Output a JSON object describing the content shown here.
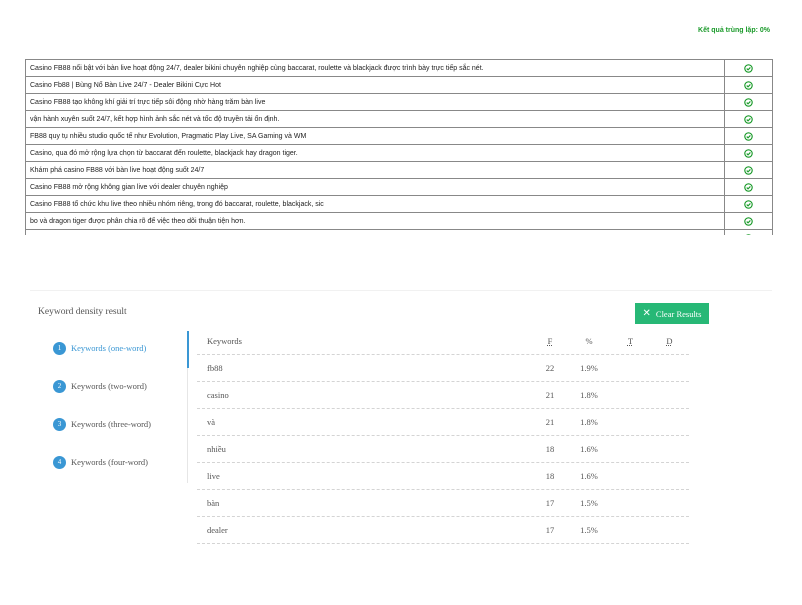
{
  "duplicate_result": "Kết quả trùng lặp: 0%",
  "sentences": [
    "Casino FB88 nổi bật với bàn live hoạt động 24/7, dealer bikini chuyên nghiệp cùng baccarat, roulette và blackjack được trình bày trực tiếp sắc nét.",
    "Casino Fb88 | Bùng Nổ Bàn Live 24/7 - Dealer Bikini Cực Hot",
    "Casino FB88 tạo không khí giải trí trực tiếp sôi động nhờ hàng trăm bàn live",
    "vận hành xuyên suốt 24/7, kết hợp hình ảnh sắc nét và tốc độ truyền tải ổn định.",
    "FB88 quy tụ nhiều studio quốc tế như Evolution, Pragmatic Play Live, SA Gaming và WM",
    "Casino, qua đó mở rộng lựa chọn từ baccarat đến roulette, blackjack hay dragon tiger.",
    "Khám phá casino FB88 với bàn live hoạt động suốt 24/7",
    "Casino FB88 mở rộng không gian live với dealer chuyên nghiệp",
    "Casino FB88 tổ chức khu live theo nhiều nhóm riêng, trong đó baccarat, roulette, blackjack, sic",
    "bo và dragon tiger được phân chia rõ để việc theo dõi thuận tiện hơn.",
    ""
  ],
  "check_icon": "check-circle-icon",
  "check_color": "#1a9a2a",
  "keyword_density": {
    "title": "Keyword density result",
    "clear_button": "Clear Results",
    "accent_color": "#3a97d4",
    "button_color": "#27b876",
    "tabs": [
      {
        "num": "1",
        "label": "Keywords (one-word)"
      },
      {
        "num": "2",
        "label": "Keywords (two-word)"
      },
      {
        "num": "3",
        "label": "Keywords (three-word)"
      },
      {
        "num": "4",
        "label": "Keywords (four-word)"
      }
    ],
    "columns": {
      "keyword": "Keywords",
      "f": "F",
      "percent": "%",
      "t": "T",
      "d": "D"
    },
    "rows": [
      {
        "keyword": "fb88",
        "f": "22",
        "percent": "1.9%"
      },
      {
        "keyword": "casino",
        "f": "21",
        "percent": "1.8%"
      },
      {
        "keyword": "và",
        "f": "21",
        "percent": "1.8%"
      },
      {
        "keyword": "nhiều",
        "f": "18",
        "percent": "1.6%"
      },
      {
        "keyword": "live",
        "f": "18",
        "percent": "1.6%"
      },
      {
        "keyword": "bàn",
        "f": "17",
        "percent": "1.5%"
      },
      {
        "keyword": "dealer",
        "f": "17",
        "percent": "1.5%"
      }
    ]
  }
}
